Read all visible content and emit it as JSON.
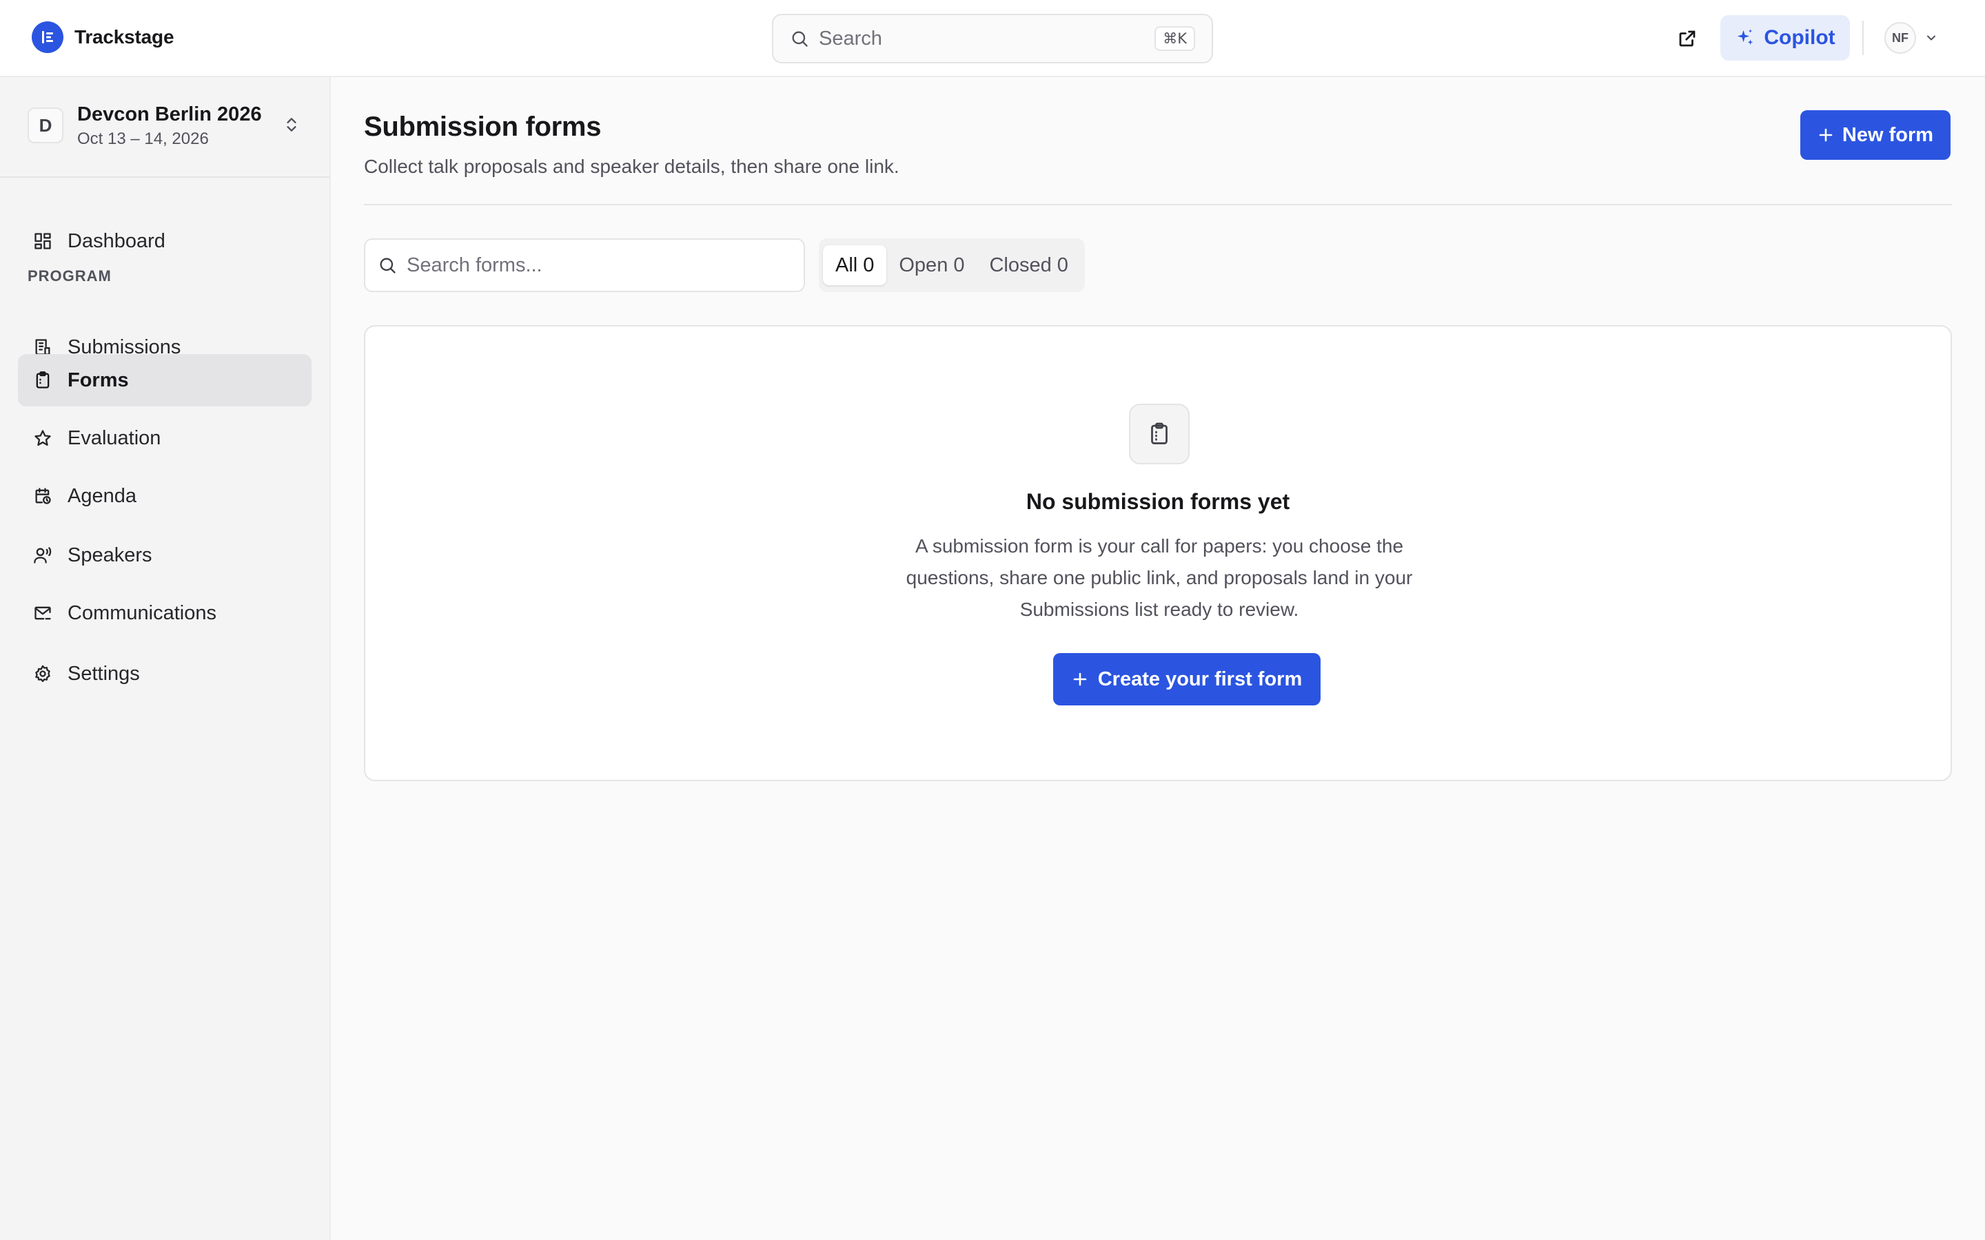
{
  "app": {
    "name": "Trackstage",
    "logo_icon": "trackstage-logo-icon",
    "accent_color": "#2b55e0"
  },
  "topbar": {
    "search_placeholder": "Search",
    "search_shortcut": "⌘K",
    "external_link_icon": "external-link-icon",
    "copilot_label": "Copilot",
    "user_initials": "NF"
  },
  "event": {
    "badge": "D",
    "name": "Devcon Berlin 2026",
    "dates": "Oct 13 – 14, 2026"
  },
  "sidebar": {
    "section_label": "PROGRAM",
    "items": [
      {
        "label": "Dashboard",
        "icon": "dashboard-icon",
        "active": false
      },
      {
        "label": "Submissions",
        "icon": "submissions-icon",
        "active": false
      },
      {
        "label": "Forms",
        "icon": "clipboard-icon",
        "active": true
      },
      {
        "label": "Evaluation",
        "icon": "star-icon",
        "active": false
      },
      {
        "label": "Agenda",
        "icon": "calendar-clock-icon",
        "active": false
      },
      {
        "label": "Speakers",
        "icon": "speaker-icon",
        "active": false
      },
      {
        "label": "Communications",
        "icon": "mail-icon",
        "active": false
      },
      {
        "label": "Settings",
        "icon": "gear-icon",
        "active": false
      }
    ]
  },
  "main": {
    "title": "Submission forms",
    "subtitle": "Collect talk proposals and speaker details, then share one link.",
    "new_form_label": "New form",
    "search_placeholder": "Search forms...",
    "tabs": [
      {
        "label": "All",
        "count": "0",
        "active": true
      },
      {
        "label": "Open",
        "count": "0",
        "active": false
      },
      {
        "label": "Closed",
        "count": "0",
        "active": false
      }
    ],
    "empty_state": {
      "icon": "clipboard-icon",
      "title": "No submission forms yet",
      "body": "A submission form is your call for papers: you choose the questions, share one public link, and proposals land in your Submissions list ready to review.",
      "cta_label": "Create your first form"
    }
  }
}
